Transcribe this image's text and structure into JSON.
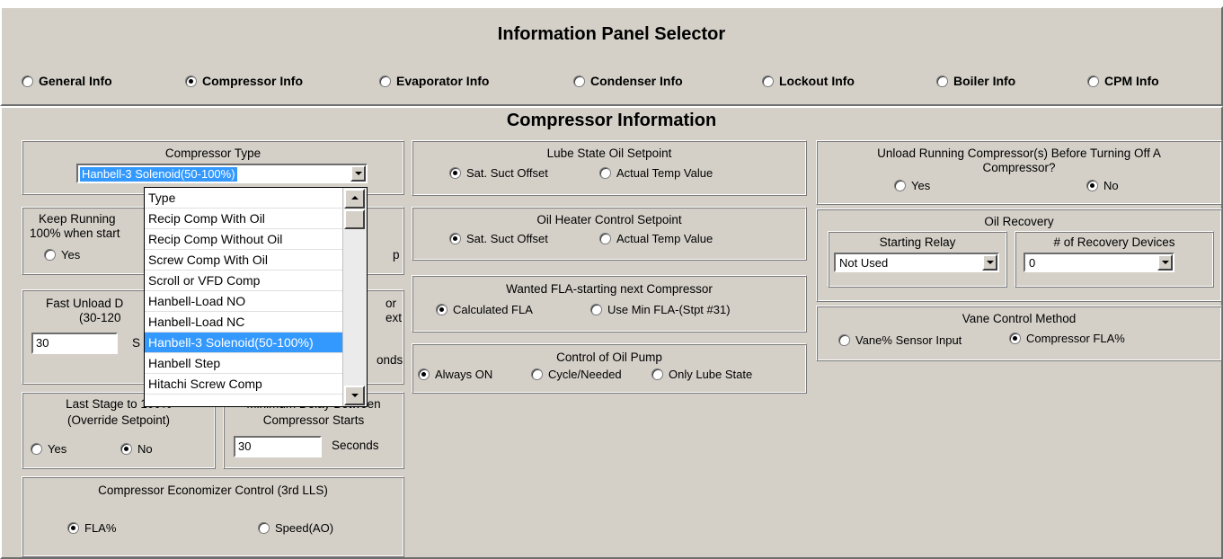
{
  "selector": {
    "title": "Information Panel Selector",
    "options": [
      {
        "label": "General Info",
        "selected": false
      },
      {
        "label": "Compressor Info",
        "selected": true
      },
      {
        "label": "Evaporator Info",
        "selected": false
      },
      {
        "label": "Condenser Info",
        "selected": false
      },
      {
        "label": "Lockout Info",
        "selected": false
      },
      {
        "label": "Boiler Info",
        "selected": false
      },
      {
        "label": "CPM Info",
        "selected": false
      }
    ]
  },
  "main": {
    "title": "Compressor Information"
  },
  "compressor_type": {
    "title": "Compressor Type",
    "value": "Hanbell-3 Solenoid(50-100%)",
    "dropdown_items": [
      "Type",
      "Recip Comp With Oil",
      "Recip Comp Without Oil",
      "Screw Comp With Oil",
      "Scroll or VFD Comp",
      "Hanbell-Load NO",
      "Hanbell-Load NC",
      "Hanbell-3 Solenoid(50-100%)",
      "Hanbell Step",
      "Hitachi Screw Comp"
    ],
    "highlighted_index": 7
  },
  "keep_running": {
    "title_line1": "Keep Running",
    "title_line2": "100% when start",
    "yes": "Yes",
    "right_fragment": "p"
  },
  "fast_unload": {
    "title_line1": "Fast Unload D",
    "title_line2": "(30-120",
    "value": "30",
    "unit_fragment": "S",
    "right_frag1": "or",
    "right_frag2": "ext",
    "right_frag3": "onds"
  },
  "last_stage": {
    "title_line1": "Last Stage to 100%",
    "title_line2": "(Override Setpoint)",
    "yes": "Yes",
    "no": "No",
    "selected": "No"
  },
  "min_delay": {
    "title_line1": "Minimum Delay Between",
    "title_line2": "Compressor Starts",
    "value": "30",
    "unit": "Seconds"
  },
  "economizer": {
    "title": "Compressor Economizer Control (3rd LLS)",
    "opt1": "FLA%",
    "opt2": "Speed(AO)",
    "selected": "FLA%"
  },
  "lube_state": {
    "title": "Lube State Oil Setpoint",
    "opt1": "Sat. Suct Offset",
    "opt2": "Actual Temp Value",
    "selected": "Sat. Suct Offset"
  },
  "oil_heater": {
    "title": "Oil Heater Control Setpoint",
    "opt1": "Sat. Suct Offset",
    "opt2": "Actual Temp Value",
    "selected": "Sat. Suct Offset"
  },
  "wanted_fla": {
    "title": "Wanted FLA-starting next Compressor",
    "opt1": "Calculated FLA",
    "opt2": "Use Min FLA-(Stpt #31)",
    "selected": "Calculated FLA"
  },
  "oil_pump": {
    "title": "Control of Oil Pump",
    "opt1": "Always ON",
    "opt2": "Cycle/Needed",
    "opt3": "Only Lube State",
    "selected": "Always ON"
  },
  "unload_running": {
    "title_line1": "Unload Running Compressor(s) Before Turning Off A",
    "title_line2": "Compressor?",
    "yes": "Yes",
    "no": "No",
    "selected": "No"
  },
  "oil_recovery": {
    "title": "Oil Recovery",
    "relay_label": "Starting Relay",
    "relay_value": "Not Used",
    "devices_label": "# of Recovery Devices",
    "devices_value": "0"
  },
  "vane_control": {
    "title": "Vane Control Method",
    "opt1": "Vane% Sensor Input",
    "opt2": "Compressor FLA%",
    "selected": "Compressor FLA%"
  },
  "colors": {
    "panel": "#d4d0c8",
    "selection": "#3399ff"
  }
}
